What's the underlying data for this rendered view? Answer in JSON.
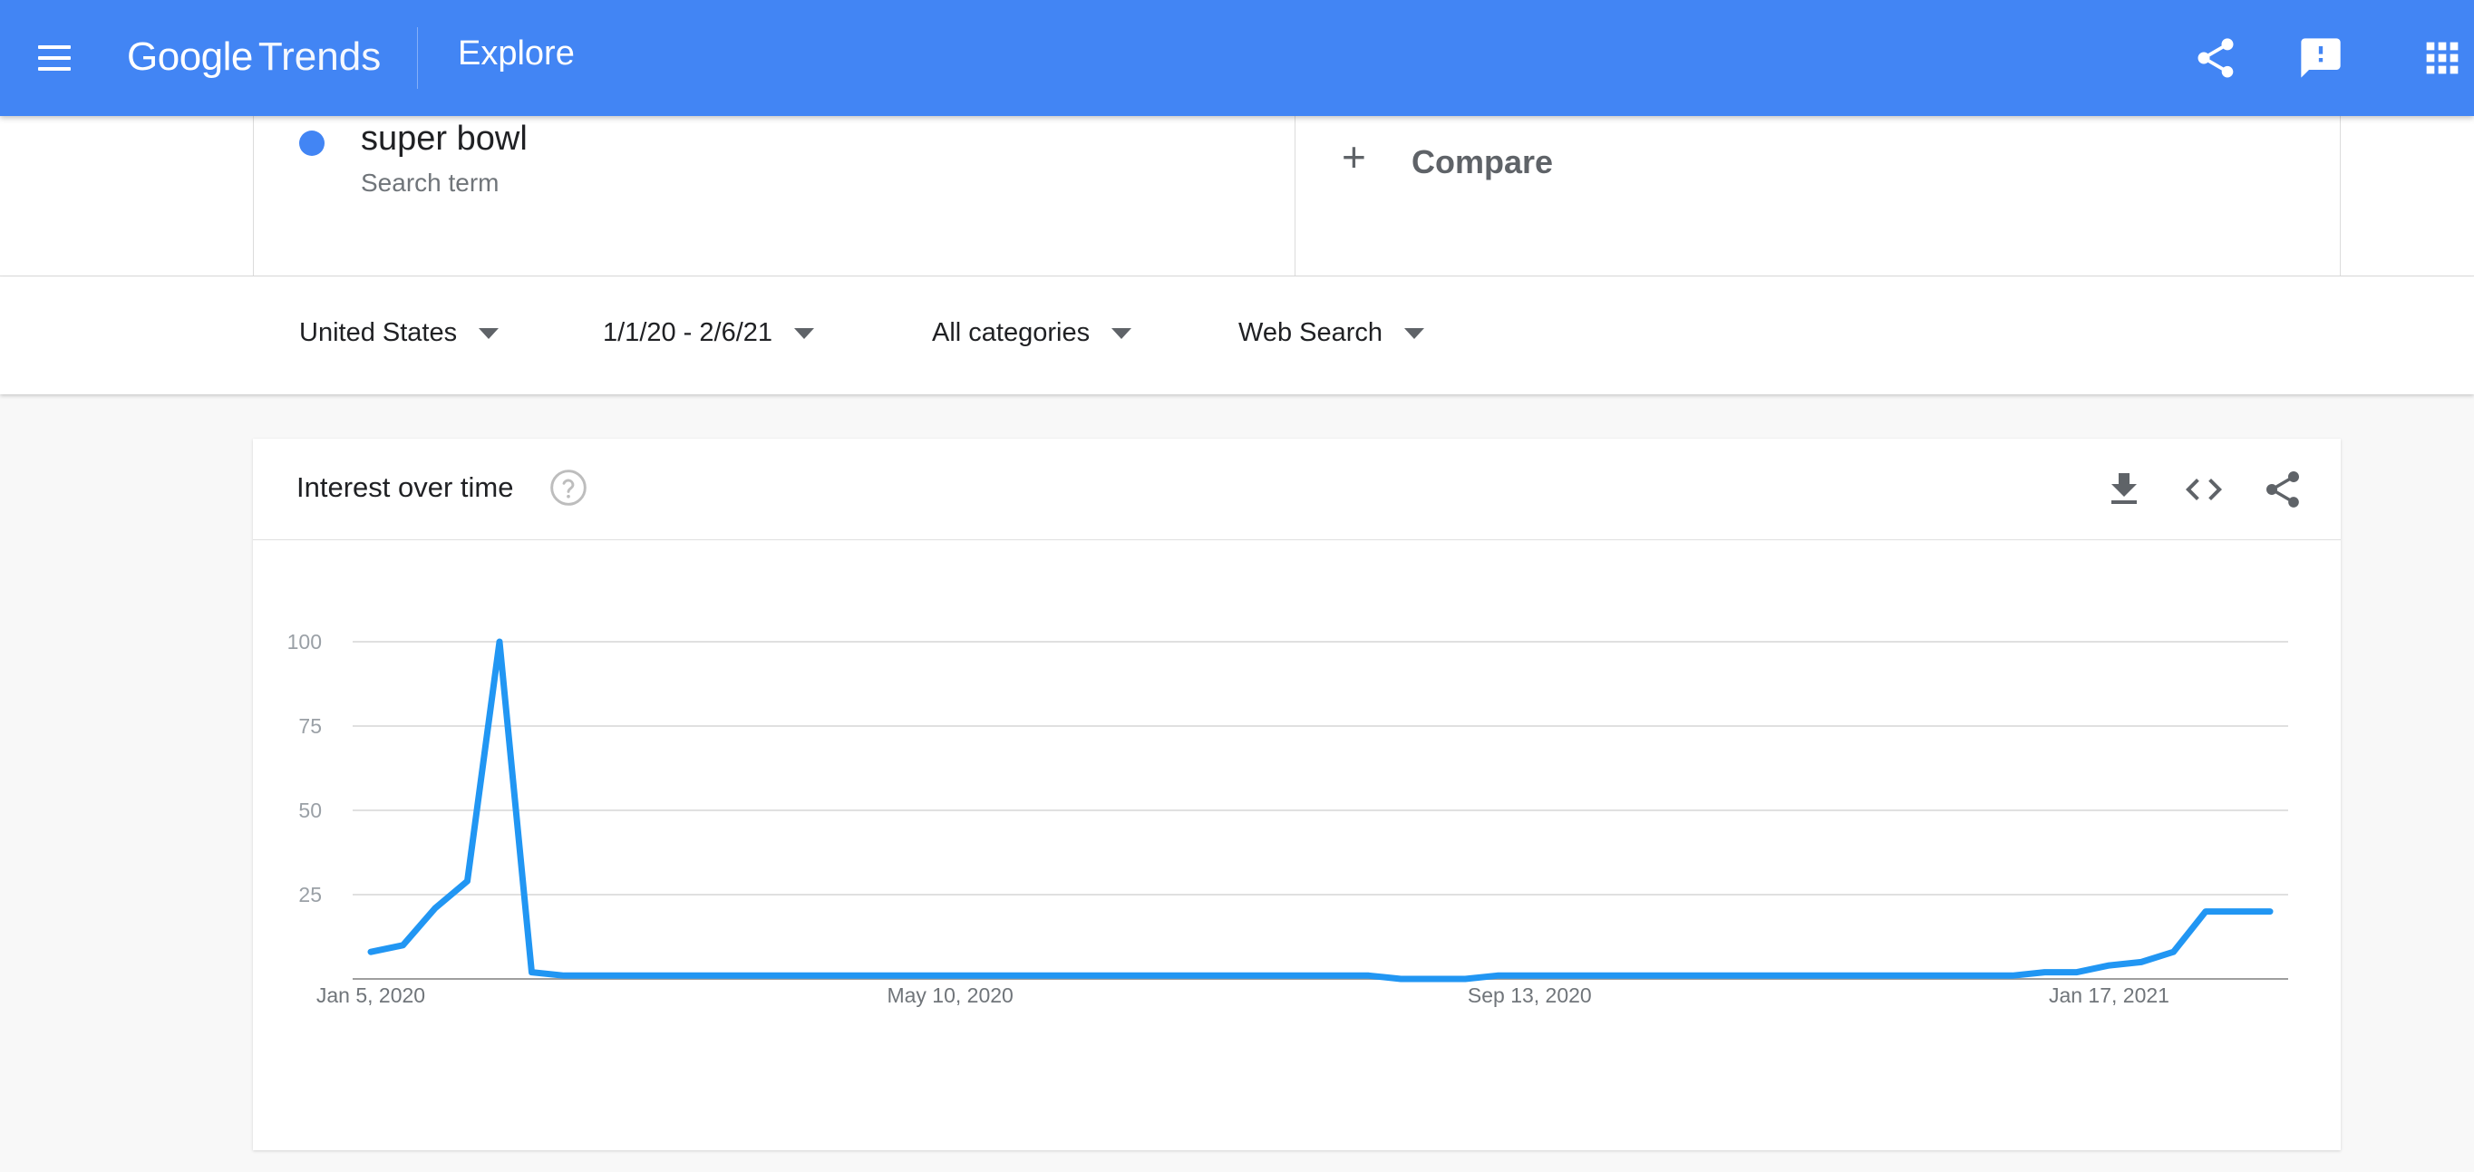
{
  "header": {
    "logo_google": "Google",
    "logo_trends": "Trends",
    "title": "Explore",
    "bg_color": "#4285f4",
    "icons": [
      "menu-icon",
      "share-icon",
      "feedback-icon",
      "apps-icon"
    ]
  },
  "search_term": {
    "name": "super bowl",
    "type": "Search term",
    "color": "#4285f4"
  },
  "compare": {
    "label": "Compare"
  },
  "filters": {
    "region": "United States",
    "date_range": "1/1/20 - 2/6/21",
    "category": "All categories",
    "search_type": "Web Search"
  },
  "interest_card": {
    "title": "Interest over time",
    "actions": [
      "download-icon",
      "embed-icon",
      "share-icon"
    ]
  },
  "chart_data": {
    "type": "line",
    "title": "",
    "xlabel": "",
    "ylabel": "",
    "ylim": [
      0,
      100
    ],
    "yticks": [
      25,
      50,
      75,
      100
    ],
    "x_tick_labels": [
      "Jan 5, 2020",
      "May 10, 2020",
      "Sep 13, 2020",
      "Jan 17, 2021"
    ],
    "x_tick_indices": [
      0,
      18,
      36,
      54
    ],
    "grid": true,
    "line_color": "#2196f3",
    "series": [
      {
        "name": "super bowl",
        "values": [
          8,
          10,
          21,
          29,
          100,
          2,
          1,
          1,
          1,
          1,
          1,
          1,
          1,
          1,
          1,
          1,
          1,
          1,
          1,
          1,
          1,
          1,
          1,
          1,
          1,
          1,
          1,
          1,
          1,
          1,
          1,
          1,
          0,
          0,
          0,
          1,
          1,
          1,
          1,
          1,
          1,
          1,
          1,
          1,
          1,
          1,
          1,
          1,
          1,
          1,
          1,
          1,
          2,
          2,
          4,
          5,
          8,
          20,
          20,
          20
        ]
      }
    ]
  }
}
